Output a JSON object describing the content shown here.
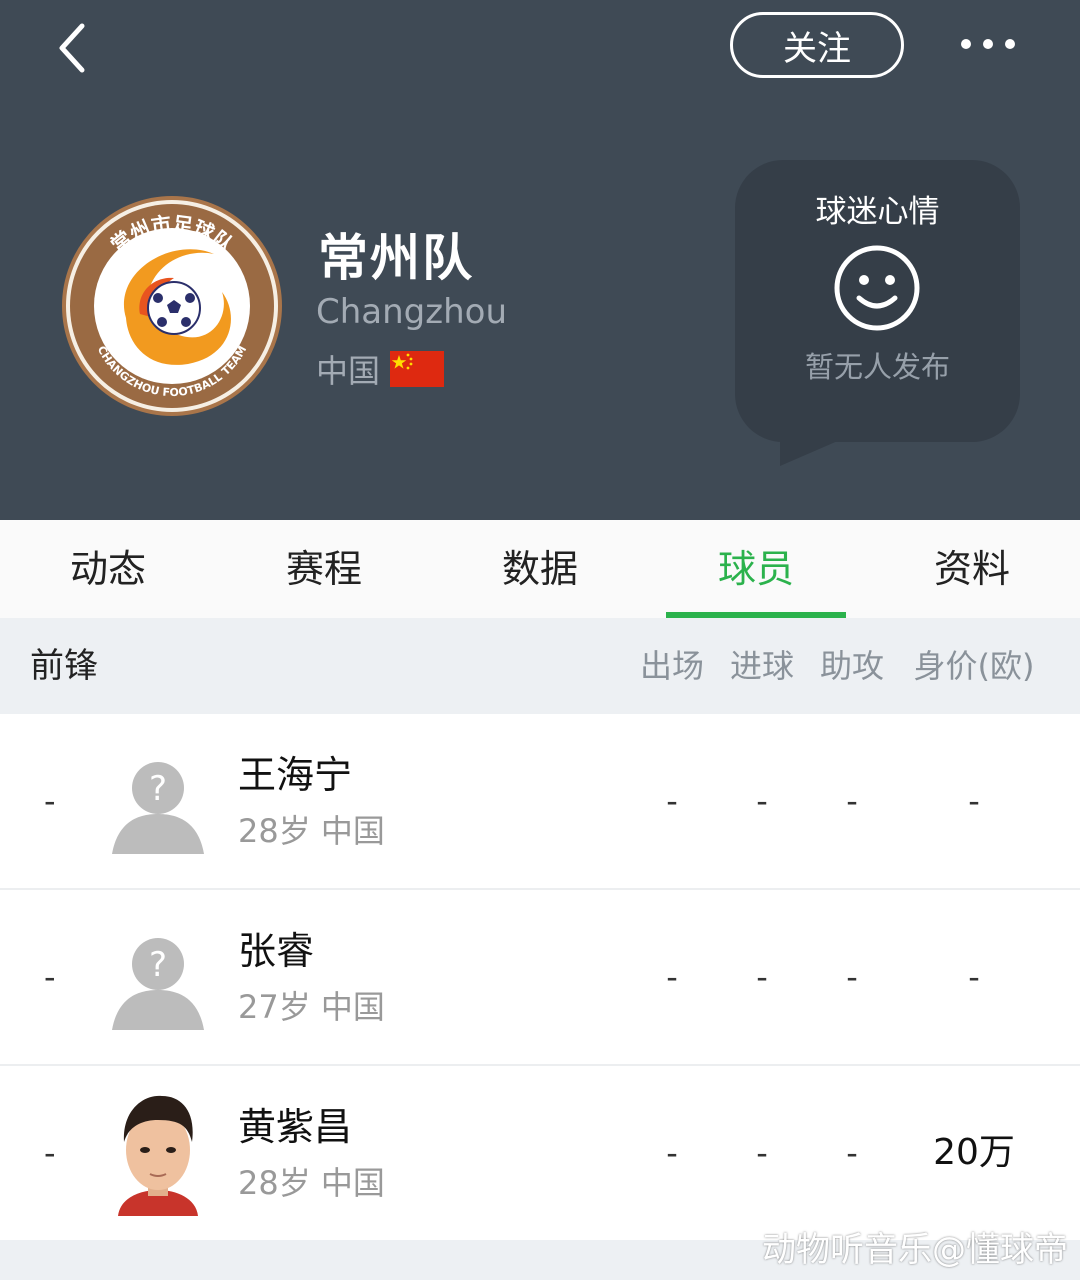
{
  "header": {
    "follow_label": "关注",
    "team_name_cn": "常州队",
    "team_name_en": "Changzhou",
    "country": "中国",
    "logo_text_top": "常州市足球队",
    "logo_text_bottom": "CHANGZHOU FOOTBALL TEAM",
    "bg_color": "#3f4a55"
  },
  "mood": {
    "title": "球迷心情",
    "empty_text": "暂无人发布"
  },
  "tabs": [
    {
      "label": "动态"
    },
    {
      "label": "赛程"
    },
    {
      "label": "数据"
    },
    {
      "label": "球员",
      "active": true
    },
    {
      "label": "资料"
    }
  ],
  "accent_color": "#2bb24c",
  "section": {
    "title": "前锋",
    "columns": [
      "出场",
      "进球",
      "助攻",
      "身价(欧)"
    ]
  },
  "players": [
    {
      "rank": "-",
      "name": "王海宁",
      "age": "28岁",
      "country": "中国",
      "apps": "-",
      "goals": "-",
      "assists": "-",
      "value": "-",
      "avatar": "placeholder"
    },
    {
      "rank": "-",
      "name": "张睿",
      "age": "27岁",
      "country": "中国",
      "apps": "-",
      "goals": "-",
      "assists": "-",
      "value": "-",
      "avatar": "placeholder"
    },
    {
      "rank": "-",
      "name": "黄紫昌",
      "age": "28岁",
      "country": "中国",
      "apps": "-",
      "goals": "-",
      "assists": "-",
      "value": "20万",
      "avatar": "photo"
    }
  ],
  "watermark": "动物听音乐@懂球帝"
}
